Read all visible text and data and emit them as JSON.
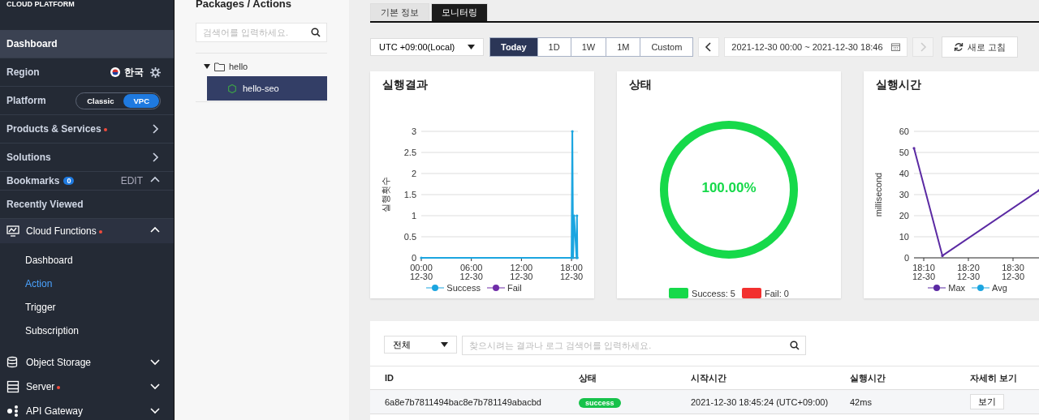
{
  "sidebar": {
    "brand": "CLOUD PLATFORM",
    "dashboard": {
      "label": "Dashboard",
      "selected": true
    },
    "region": {
      "label": "Region",
      "value": "한국"
    },
    "platform": {
      "label": "Platform",
      "options": [
        {
          "label": "Classic",
          "selected": false
        },
        {
          "label": "VPC",
          "selected": true
        }
      ]
    },
    "menu": [
      {
        "label": "Products & Services",
        "new": true
      },
      {
        "label": "Solutions",
        "new": false
      }
    ],
    "bookmarks": {
      "label": "Bookmarks",
      "count": "0",
      "edit": "EDIT"
    },
    "recent": "Recently Viewed",
    "services": [
      {
        "label": "Cloud Functions",
        "kind": "monitor",
        "new": true,
        "expanded": true,
        "children": [
          {
            "label": "Dashboard",
            "selected": false
          },
          {
            "label": "Action",
            "selected": true
          },
          {
            "label": "Trigger",
            "selected": false
          },
          {
            "label": "Subscription",
            "selected": false
          }
        ]
      },
      {
        "label": "Object Storage",
        "kind": "storage",
        "new": false,
        "expanded": false
      },
      {
        "label": "Server",
        "kind": "server",
        "new": true,
        "expanded": false
      },
      {
        "label": "API Gateway",
        "kind": "gateway",
        "new": false,
        "expanded": false
      }
    ]
  },
  "packages": {
    "title": "Packages / Actions",
    "search": {
      "placeholder": "검색어를 입력하세요."
    },
    "tree": [
      {
        "label": "hello",
        "expanded": true,
        "children": [
          {
            "label": "hello-seo",
            "selected": true
          }
        ]
      }
    ]
  },
  "tabs": [
    {
      "label": "기본 정보",
      "selected": false
    },
    {
      "label": "모니터링",
      "selected": true
    }
  ],
  "toolbar": {
    "timezone": "UTC +09:00(Local)",
    "ranges": [
      {
        "label": "Today",
        "selected": true
      },
      {
        "label": "1D",
        "selected": false
      },
      {
        "label": "1W",
        "selected": false
      },
      {
        "label": "1M",
        "selected": false
      },
      {
        "label": "Custom",
        "selected": false
      }
    ],
    "period": "2021-12-30 00:00 ~ 2021-12-30 18:46",
    "refresh": "새로 고침"
  },
  "cards": [
    {
      "title": "실행결과",
      "x_dates": [
        "12-30",
        "12-30",
        "12-30",
        "12-30"
      ],
      "chart_data": {
        "type": "line",
        "grid": true,
        "ylabel": "실행횟수",
        "x": [
          0,
          18.0,
          18.1,
          18.2,
          18.3,
          18.6,
          18.65,
          18.7
        ],
        "xlim": [
          0,
          18.77
        ],
        "ylim": [
          0,
          3
        ],
        "xticks": [
          {
            "value": 0,
            "label": "00:00"
          },
          {
            "value": 6,
            "label": "06:00"
          },
          {
            "value": 12,
            "label": "12:00"
          },
          {
            "value": 18,
            "label": "18:00"
          }
        ],
        "yticks": [
          0,
          0.5,
          1,
          1.5,
          2,
          2.5,
          3
        ],
        "series": [
          {
            "name": "Fail",
            "color": "#6f2da8",
            "values": [
              null,
              null,
              null,
              null,
              null,
              null,
              null,
              null
            ]
          },
          {
            "name": "Success",
            "color": "#1ba5e0",
            "values": [
              0,
              0,
              3,
              0,
              1,
              0,
              1,
              0
            ]
          }
        ]
      }
    },
    {
      "title": "상태",
      "rate": "100.00%",
      "legend": [
        {
          "label": "Success: 5",
          "color": "#16d94a"
        },
        {
          "label": "Fail: 0",
          "color": "#f2302f"
        }
      ],
      "chart_data": {
        "type": "pie",
        "values": [
          100,
          0
        ]
      }
    },
    {
      "title": "실행시간",
      "x_dates": [
        "12-30",
        "12-30",
        "12-30"
      ],
      "chart_data": {
        "type": "line",
        "grid": true,
        "ylabel": "millisecond",
        "x": [
          18.1303,
          18.2364,
          18.597
        ],
        "xlim": [
          18.1303,
          18.7788
        ],
        "ylim": [
          0,
          60
        ],
        "xticks": [
          {
            "value": 18.1667,
            "label": "18:10"
          },
          {
            "value": 18.3333,
            "label": "18:20"
          },
          {
            "value": 18.5,
            "label": "18:30"
          }
        ],
        "yticks": [
          0,
          10,
          20,
          30,
          40,
          50,
          60
        ],
        "series": [
          {
            "name": "Avg",
            "color": "#1ba5e0",
            "values": [
              null,
              null,
              null
            ]
          },
          {
            "name": "Max",
            "color": "#5b2aa3",
            "values": [
              52,
              1,
              32
            ]
          }
        ]
      }
    }
  ],
  "logs": {
    "filter": "전체",
    "search": {
      "placeholder": "찾으시려는 결과나 로그 검색어를 입력하세요."
    },
    "columns": [
      "ID",
      "상태",
      "시작시간",
      "실행시간",
      "자세히 보기"
    ],
    "rows": [
      {
        "id": "6a8e7b7811494bac8e7b781149abacbd",
        "status": "success",
        "start": "2021-12-30 18:45:24 (UTC+09:00)",
        "duration": "42ms",
        "action": "보기"
      }
    ]
  }
}
